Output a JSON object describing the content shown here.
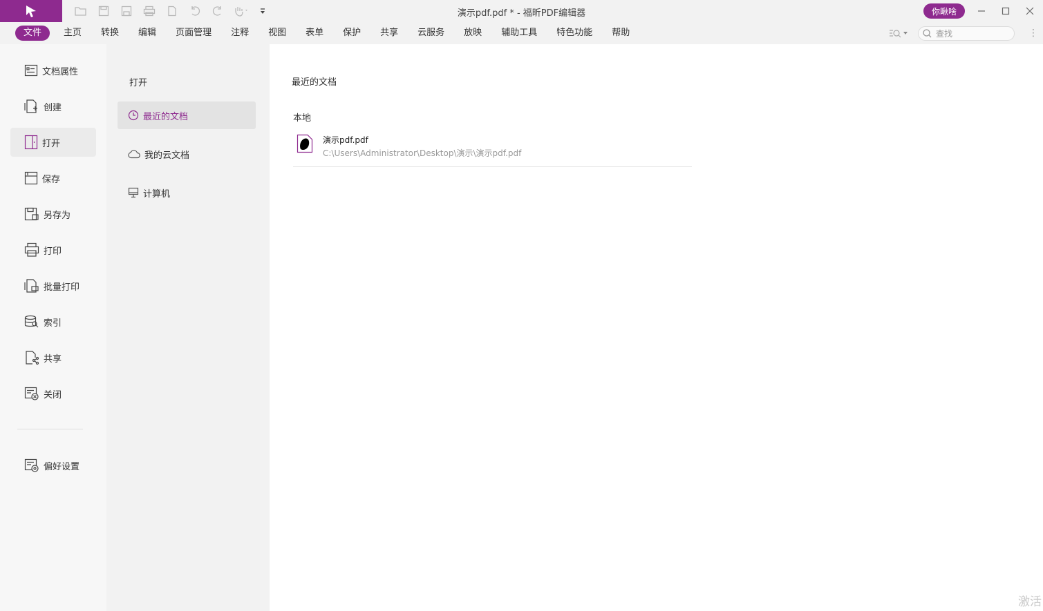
{
  "window": {
    "title": "演示pdf.pdf * - 福昕PDF编辑器",
    "user_badge": "你瞅啥"
  },
  "quick_access": [
    "open-icon",
    "save-icon",
    "save-as-icon",
    "print-icon",
    "new-icon",
    "undo-icon",
    "redo-icon",
    "hand-icon",
    "customize-icon"
  ],
  "menu": {
    "items": [
      "文件",
      "主页",
      "转换",
      "编辑",
      "页面管理",
      "注释",
      "视图",
      "表单",
      "保护",
      "共享",
      "云服务",
      "放映",
      "辅助工具",
      "特色功能",
      "帮助"
    ],
    "active": "文件"
  },
  "search": {
    "placeholder": "查找"
  },
  "left_nav": {
    "items": [
      {
        "label": "文档属性",
        "icon": "properties-icon"
      },
      {
        "label": "创建",
        "icon": "create-icon"
      },
      {
        "label": "打开",
        "icon": "open-icon"
      },
      {
        "label": "保存",
        "icon": "save-icon"
      },
      {
        "label": "另存为",
        "icon": "save-as-icon"
      },
      {
        "label": "打印",
        "icon": "print-icon"
      },
      {
        "label": "批量打印",
        "icon": "batch-print-icon"
      },
      {
        "label": "索引",
        "icon": "index-icon"
      },
      {
        "label": "共享",
        "icon": "share-icon"
      },
      {
        "label": "关闭",
        "icon": "close-doc-icon"
      }
    ],
    "preferences": {
      "label": "偏好设置",
      "icon": "preferences-icon"
    },
    "active": "打开"
  },
  "open_panel": {
    "title": "打开",
    "items": [
      {
        "label": "最近的文档",
        "icon": "clock-icon"
      },
      {
        "label": "我的云文档",
        "icon": "cloud-icon"
      },
      {
        "label": "计算机",
        "icon": "computer-icon"
      }
    ],
    "active": "最近的文档"
  },
  "recent": {
    "title": "最近的文档",
    "section": "本地",
    "files": [
      {
        "name": "演示pdf.pdf",
        "path": "C:\\Users\\Administrator\\Desktop\\演示\\演示pdf.pdf"
      }
    ]
  },
  "watermark": "激活",
  "colors": {
    "accent": "#8e2a8f"
  }
}
